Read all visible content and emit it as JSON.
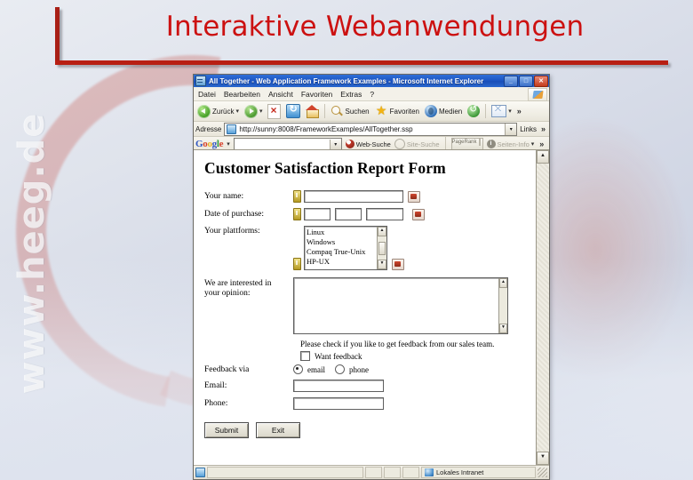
{
  "slide": {
    "title": "Interaktive Webanwendungen",
    "watermark": "www.heeg.de",
    "title_color": "#cc1111",
    "accent_color": "#b81f13"
  },
  "browser": {
    "window_title": "All Together - Web Application Framework Examples - Microsoft Internet Explorer",
    "window_buttons": {
      "minimize": "_",
      "maximize": "□",
      "close": "✕"
    },
    "menu": [
      "Datei",
      "Bearbeiten",
      "Ansicht",
      "Favoriten",
      "Extras",
      "?"
    ],
    "toolbar": {
      "back": "Zurück",
      "forward": "",
      "dropdown_caret": "▾",
      "search": "Suchen",
      "favorites": "Favoriten",
      "media": "Medien",
      "overflow": "»"
    },
    "address": {
      "label": "Adresse",
      "url": "http://sunny:8008/FrameworkExamples/AllTogether.ssp",
      "dropdown_caret": "▾",
      "links_label": "Links",
      "overflow": "»"
    },
    "google_toolbar": {
      "logo": [
        {
          "ch": "G",
          "cls": "b"
        },
        {
          "ch": "o",
          "cls": "r"
        },
        {
          "ch": "o",
          "cls": "y"
        },
        {
          "ch": "g",
          "cls": "b"
        },
        {
          "ch": "l",
          "cls": "g"
        },
        {
          "ch": "e",
          "cls": "r"
        }
      ],
      "logo_caret": "▾",
      "search_value": "",
      "web_search": "Web-Suche",
      "site_search": "Site-Suche",
      "pagerank": "PageRank",
      "page_info": "Seiten-Info",
      "page_info_caret": "▾",
      "overflow": "»"
    },
    "status": {
      "zone": "Lokales Intranet"
    },
    "scrollbar": {
      "up": "▲",
      "down": "▼"
    }
  },
  "form": {
    "heading": "Customer Satisfaction Report Form",
    "fields": {
      "name_label": "Your name:",
      "name_value": "",
      "date_label": "Date of purchase:",
      "date_day": "",
      "date_month": "",
      "date_year": "",
      "platform_label": "Your plattforms:",
      "platform_options": [
        "Linux",
        "Windows",
        "Compaq True-Unix",
        "HP-UX"
      ],
      "opinion_label_line1": "We are interested in",
      "opinion_label_line2": "your opinion:",
      "opinion_value": "",
      "feedback_note": "Please check if you like to get feedback from our sales team.",
      "want_feedback_label": "Want feedback",
      "want_feedback_checked": false,
      "feedback_via_label": "Feedback via",
      "radio_email": "email",
      "radio_phone": "phone",
      "radio_selected": "email",
      "email_label": "Email:",
      "email_value": "",
      "phone_label": "Phone:",
      "phone_value": ""
    },
    "buttons": {
      "submit": "Submit",
      "exit": "Exit"
    },
    "listbox_scroll": {
      "up": "▲",
      "down": "▼"
    }
  }
}
